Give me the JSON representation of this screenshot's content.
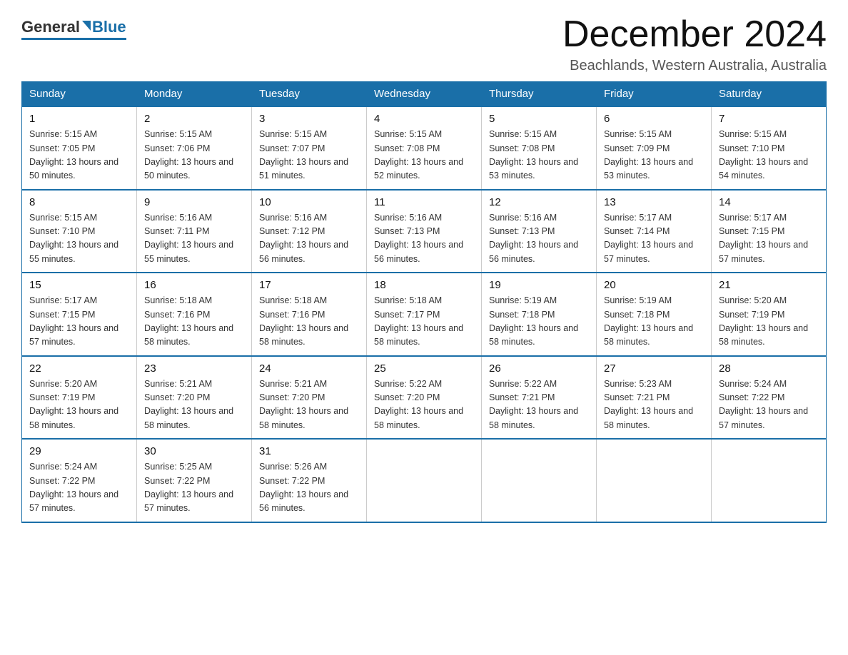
{
  "header": {
    "logo": {
      "general": "General",
      "blue": "Blue"
    },
    "title": "December 2024",
    "location": "Beachlands, Western Australia, Australia"
  },
  "weekdays": [
    "Sunday",
    "Monday",
    "Tuesday",
    "Wednesday",
    "Thursday",
    "Friday",
    "Saturday"
  ],
  "weeks": [
    [
      {
        "day": "1",
        "sunrise": "5:15 AM",
        "sunset": "7:05 PM",
        "daylight": "13 hours and 50 minutes."
      },
      {
        "day": "2",
        "sunrise": "5:15 AM",
        "sunset": "7:06 PM",
        "daylight": "13 hours and 50 minutes."
      },
      {
        "day": "3",
        "sunrise": "5:15 AM",
        "sunset": "7:07 PM",
        "daylight": "13 hours and 51 minutes."
      },
      {
        "day": "4",
        "sunrise": "5:15 AM",
        "sunset": "7:08 PM",
        "daylight": "13 hours and 52 minutes."
      },
      {
        "day": "5",
        "sunrise": "5:15 AM",
        "sunset": "7:08 PM",
        "daylight": "13 hours and 53 minutes."
      },
      {
        "day": "6",
        "sunrise": "5:15 AM",
        "sunset": "7:09 PM",
        "daylight": "13 hours and 53 minutes."
      },
      {
        "day": "7",
        "sunrise": "5:15 AM",
        "sunset": "7:10 PM",
        "daylight": "13 hours and 54 minutes."
      }
    ],
    [
      {
        "day": "8",
        "sunrise": "5:15 AM",
        "sunset": "7:10 PM",
        "daylight": "13 hours and 55 minutes."
      },
      {
        "day": "9",
        "sunrise": "5:16 AM",
        "sunset": "7:11 PM",
        "daylight": "13 hours and 55 minutes."
      },
      {
        "day": "10",
        "sunrise": "5:16 AM",
        "sunset": "7:12 PM",
        "daylight": "13 hours and 56 minutes."
      },
      {
        "day": "11",
        "sunrise": "5:16 AM",
        "sunset": "7:13 PM",
        "daylight": "13 hours and 56 minutes."
      },
      {
        "day": "12",
        "sunrise": "5:16 AM",
        "sunset": "7:13 PM",
        "daylight": "13 hours and 56 minutes."
      },
      {
        "day": "13",
        "sunrise": "5:17 AM",
        "sunset": "7:14 PM",
        "daylight": "13 hours and 57 minutes."
      },
      {
        "day": "14",
        "sunrise": "5:17 AM",
        "sunset": "7:15 PM",
        "daylight": "13 hours and 57 minutes."
      }
    ],
    [
      {
        "day": "15",
        "sunrise": "5:17 AM",
        "sunset": "7:15 PM",
        "daylight": "13 hours and 57 minutes."
      },
      {
        "day": "16",
        "sunrise": "5:18 AM",
        "sunset": "7:16 PM",
        "daylight": "13 hours and 58 minutes."
      },
      {
        "day": "17",
        "sunrise": "5:18 AM",
        "sunset": "7:16 PM",
        "daylight": "13 hours and 58 minutes."
      },
      {
        "day": "18",
        "sunrise": "5:18 AM",
        "sunset": "7:17 PM",
        "daylight": "13 hours and 58 minutes."
      },
      {
        "day": "19",
        "sunrise": "5:19 AM",
        "sunset": "7:18 PM",
        "daylight": "13 hours and 58 minutes."
      },
      {
        "day": "20",
        "sunrise": "5:19 AM",
        "sunset": "7:18 PM",
        "daylight": "13 hours and 58 minutes."
      },
      {
        "day": "21",
        "sunrise": "5:20 AM",
        "sunset": "7:19 PM",
        "daylight": "13 hours and 58 minutes."
      }
    ],
    [
      {
        "day": "22",
        "sunrise": "5:20 AM",
        "sunset": "7:19 PM",
        "daylight": "13 hours and 58 minutes."
      },
      {
        "day": "23",
        "sunrise": "5:21 AM",
        "sunset": "7:20 PM",
        "daylight": "13 hours and 58 minutes."
      },
      {
        "day": "24",
        "sunrise": "5:21 AM",
        "sunset": "7:20 PM",
        "daylight": "13 hours and 58 minutes."
      },
      {
        "day": "25",
        "sunrise": "5:22 AM",
        "sunset": "7:20 PM",
        "daylight": "13 hours and 58 minutes."
      },
      {
        "day": "26",
        "sunrise": "5:22 AM",
        "sunset": "7:21 PM",
        "daylight": "13 hours and 58 minutes."
      },
      {
        "day": "27",
        "sunrise": "5:23 AM",
        "sunset": "7:21 PM",
        "daylight": "13 hours and 58 minutes."
      },
      {
        "day": "28",
        "sunrise": "5:24 AM",
        "sunset": "7:22 PM",
        "daylight": "13 hours and 57 minutes."
      }
    ],
    [
      {
        "day": "29",
        "sunrise": "5:24 AM",
        "sunset": "7:22 PM",
        "daylight": "13 hours and 57 minutes."
      },
      {
        "day": "30",
        "sunrise": "5:25 AM",
        "sunset": "7:22 PM",
        "daylight": "13 hours and 57 minutes."
      },
      {
        "day": "31",
        "sunrise": "5:26 AM",
        "sunset": "7:22 PM",
        "daylight": "13 hours and 56 minutes."
      },
      null,
      null,
      null,
      null
    ]
  ]
}
